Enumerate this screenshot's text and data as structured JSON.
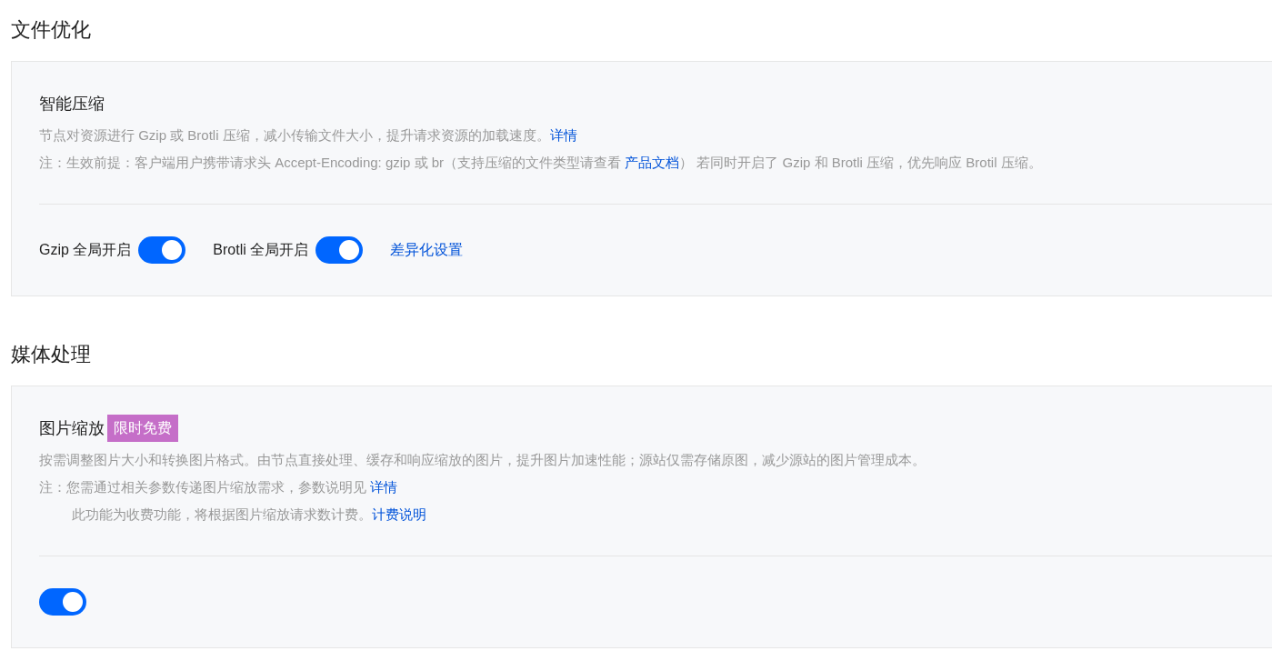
{
  "sections": [
    {
      "title": "文件优化",
      "card": {
        "title": "智能压缩",
        "lines": [
          {
            "kind": "desc",
            "segments": [
              {
                "text": "节点对资源进行 Gzip 或 Brotli 压缩，减小传输文件大小，提升请求资源的加载速度。",
                "link": false
              },
              {
                "text": "详情",
                "link": true
              }
            ]
          },
          {
            "kind": "note",
            "segments": [
              {
                "text": "注：生效前提：客户端用户携带请求头 Accept-Encoding: gzip 或 br（支持压缩的文件类型请查看 ",
                "link": false
              },
              {
                "text": "产品文档",
                "link": true
              },
              {
                "text": "） 若同时开启了 Gzip 和 Brotli 压缩，优先响应 Brotil 压缩。",
                "link": false
              }
            ]
          }
        ],
        "controls": [
          {
            "kind": "toggle",
            "label": "Gzip 全局开启",
            "on": true
          },
          {
            "kind": "toggle",
            "label": "Brotli 全局开启",
            "on": true
          },
          {
            "kind": "link",
            "label": "差异化设置"
          }
        ]
      }
    },
    {
      "title": "媒体处理",
      "card": {
        "title": "图片缩放",
        "badge": "限时免费",
        "lines": [
          {
            "kind": "desc",
            "segments": [
              {
                "text": "按需调整图片大小和转换图片格式。由节点直接处理、缓存和响应缩放的图片，提升图片加速性能；源站仅需存储原图，减少源站的图片管理成本。",
                "link": false
              }
            ]
          },
          {
            "kind": "note",
            "segments": [
              {
                "text": "注：您需通过相关参数传递图片缩放需求，参数说明见 ",
                "link": false
              },
              {
                "text": "详情",
                "link": true
              }
            ]
          },
          {
            "kind": "note-cont",
            "segments": [
              {
                "text": "此功能为收费功能，将根据图片缩放请求数计费。",
                "link": false
              },
              {
                "text": "计费说明",
                "link": true
              }
            ]
          }
        ],
        "controls": [
          {
            "kind": "toggle",
            "on": true
          }
        ]
      }
    }
  ]
}
